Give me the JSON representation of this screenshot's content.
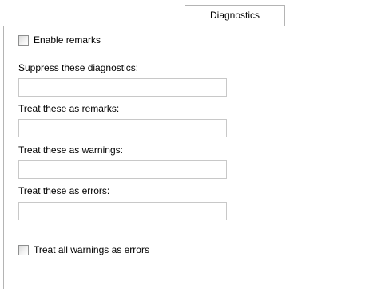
{
  "tab": {
    "label": "Diagnostics"
  },
  "enable_remarks": {
    "label": "Enable remarks",
    "checked": false
  },
  "fields": [
    {
      "label": "Suppress these diagnostics:",
      "value": ""
    },
    {
      "label": "Treat these as remarks:",
      "value": ""
    },
    {
      "label": "Treat these as warnings:",
      "value": ""
    },
    {
      "label": "Treat these as errors:",
      "value": ""
    }
  ],
  "treat_warnings_as_errors": {
    "label": "Treat all warnings as errors",
    "checked": false
  }
}
